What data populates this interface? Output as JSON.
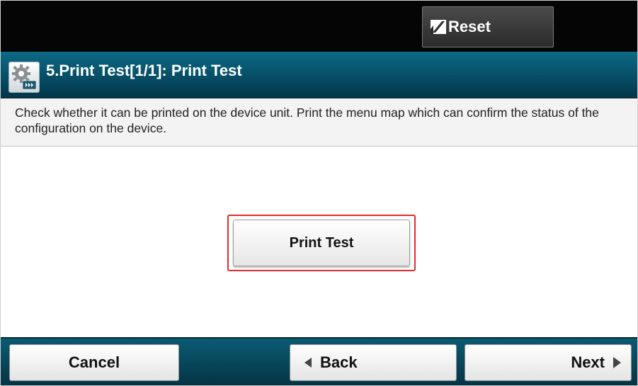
{
  "topbar": {
    "reset_label": "Reset",
    "reset_icon": "reset-slash-icon"
  },
  "header": {
    "title": "5.Print Test[1/1]: Print Test",
    "icon": "settings-gear-icon"
  },
  "description": {
    "text": "Check whether it can be printed on the device unit. Print the menu map which can confirm the status of the configuration on the device."
  },
  "main": {
    "print_test_label": "Print Test",
    "highlight_color": "#e32b2b"
  },
  "footer": {
    "cancel_label": "Cancel",
    "back_label": "Back",
    "next_label": "Next"
  },
  "colors": {
    "title_bar": "#064e66",
    "top_bar": "#050505"
  }
}
